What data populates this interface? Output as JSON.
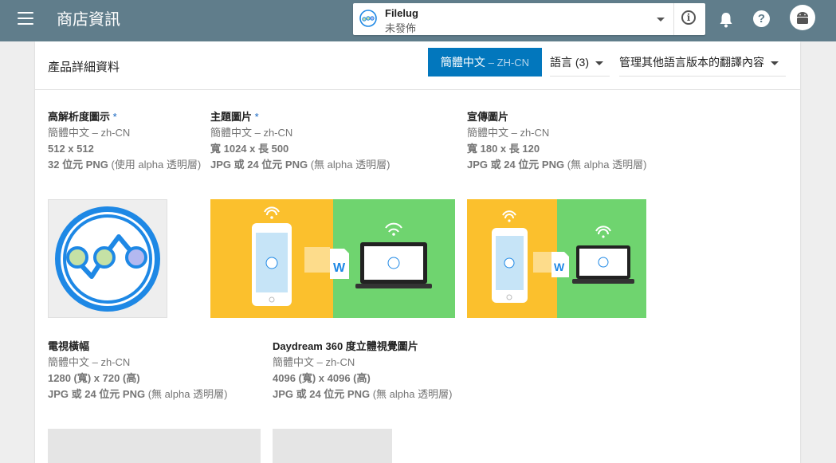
{
  "header": {
    "title": "商店資訊"
  },
  "app_selector": {
    "name": "Filelug",
    "status": "未發佈"
  },
  "icons": {
    "menu": "hamburger-menu-icon",
    "logo": "filelug-logo-icon",
    "info": "info-icon",
    "bell": "notification-bell-icon",
    "help": "help-icon",
    "avatar": "android-avatar-icon"
  },
  "card": {
    "title": "產品詳細資料",
    "lang_primary": {
      "label": "簡體中文",
      "code": "– ZH-CN"
    },
    "lang_count": "語言 (3)",
    "manage_translations": "管理其他語言版本的翻譯內容"
  },
  "assets": [
    {
      "title": "高解析度圖示",
      "required": "*",
      "lang": "簡體中文 – zh-CN",
      "size": "512 x 512",
      "format_bold": "32 位元 PNG",
      "format_rest": " (使用 alpha 透明層)"
    },
    {
      "title": "主題圖片",
      "required": "*",
      "lang": "簡體中文 – zh-CN",
      "size": "寬 1024 x 長 500",
      "format_bold": "JPG 或 24 位元 PNG",
      "format_rest": " (無 alpha 透明層)"
    },
    {
      "title": "宣傳圖片",
      "required": "",
      "lang": "簡體中文 – zh-CN",
      "size": "寬 180 x 長 120",
      "format_bold": "JPG 或 24 位元 PNG",
      "format_rest": " (無 alpha 透明層)"
    },
    {
      "title": "電視橫幅",
      "required": "",
      "lang": "簡體中文 – zh-CN",
      "size": "1280 (寬) x 720 (高)",
      "format_bold": "JPG 或 24 位元 PNG",
      "format_rest": " (無 alpha 透明層)"
    },
    {
      "title": "Daydream 360 度立體視覺圖片",
      "required": "",
      "lang": "簡體中文 – zh-CN",
      "size": "4096 (寬) x 4096 (高)",
      "format_bold": "JPG 或 24 位元 PNG",
      "format_rest": " (無 alpha 透明層)"
    }
  ],
  "colors": {
    "topbar": "#607d8b",
    "accent": "#0277bd",
    "feature_left": "#fbc02d",
    "feature_right": "#6fd46f",
    "logo_blue": "#1e88e5"
  }
}
